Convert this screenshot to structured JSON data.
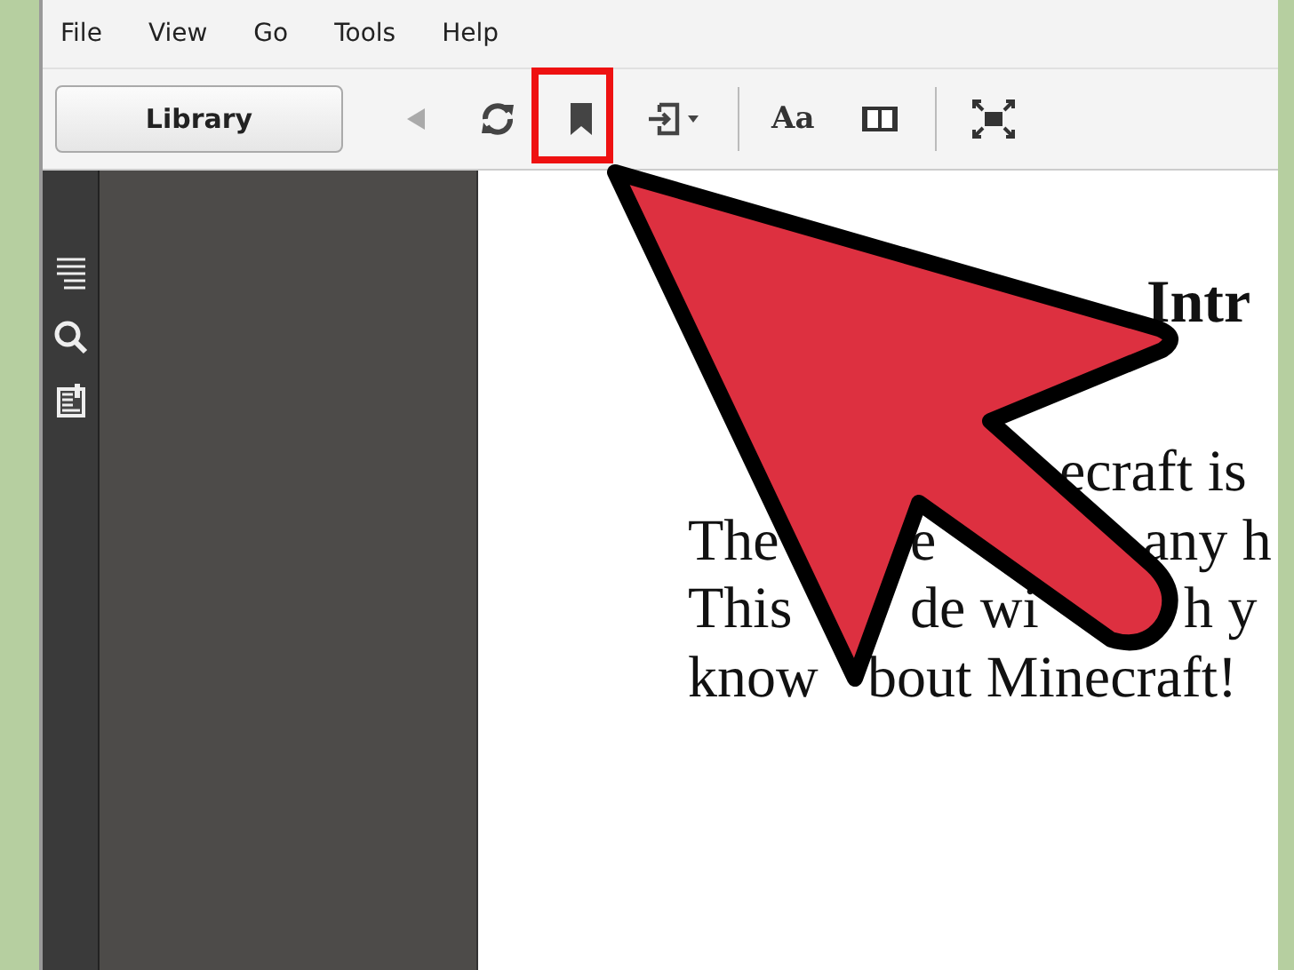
{
  "menu": [
    "File",
    "View",
    "Go",
    "Tools",
    "Help"
  ],
  "toolbar": {
    "library_button": "Library",
    "back_disabled": true,
    "font_button": "Aa"
  },
  "page": {
    "heading": "Intr",
    "lines": [
      [
        "ecraft is"
      ],
      [
        "The",
        "e",
        "any h"
      ],
      [
        "This",
        "de wi",
        "h y"
      ],
      [
        "know",
        "bout Minecraft!"
      ]
    ]
  }
}
